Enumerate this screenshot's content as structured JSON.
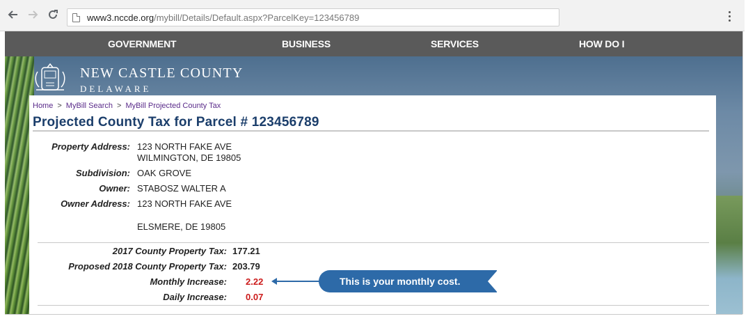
{
  "browser": {
    "url_host": "www3.nccde.org",
    "url_path": "/mybill/Details/Default.aspx?ParcelKey=123456789",
    "back_icon": "arrow-left-icon",
    "forward_icon": "arrow-right-icon",
    "reload_icon": "reload-icon",
    "menu_icon": "kebab-menu-icon"
  },
  "nav": {
    "items": [
      {
        "label": "GOVERNMENT"
      },
      {
        "label": "BUSINESS"
      },
      {
        "label": "SERVICES"
      },
      {
        "label": "HOW DO I"
      }
    ]
  },
  "brand": {
    "title": "NEW CASTLE COUNTY",
    "subtitle": "DELAWARE"
  },
  "breadcrumb": {
    "items": [
      {
        "label": "Home"
      },
      {
        "label": "MyBill Search"
      },
      {
        "label": "MyBill Projected County Tax"
      }
    ],
    "separator": ">"
  },
  "page": {
    "title": "Projected County Tax for Parcel # 123456789"
  },
  "property": {
    "address_label": "Property Address:",
    "address_line1": "123 NORTH FAKE AVE",
    "address_line2": "WILMINGTON, DE 19805",
    "subdivision_label": "Subdivision:",
    "subdivision": "OAK GROVE",
    "owner_label": "Owner:",
    "owner": "STABOSZ WALTER A",
    "owner_address_label": "Owner Address:",
    "owner_address_line1": "123 NORTH FAKE AVE",
    "owner_address_line2": "ELSMERE, DE 19805"
  },
  "tax": {
    "current_label": "2017 County Property Tax:",
    "current_value": "177.21",
    "proposed_label": "Proposed 2018 County Property Tax:",
    "proposed_value": "203.79",
    "monthly_label": "Monthly Increase:",
    "monthly_value": "2.22",
    "daily_label": "Daily Increase:",
    "daily_value": "0.07"
  },
  "callout": {
    "text": "This is your monthly cost."
  },
  "colors": {
    "nav_bg": "#5a5a5a",
    "title_blue": "#1b3e6b",
    "link_purple": "#5a2b8a",
    "increase_red": "#cc1b1b",
    "callout_blue": "#2d6aa8"
  }
}
